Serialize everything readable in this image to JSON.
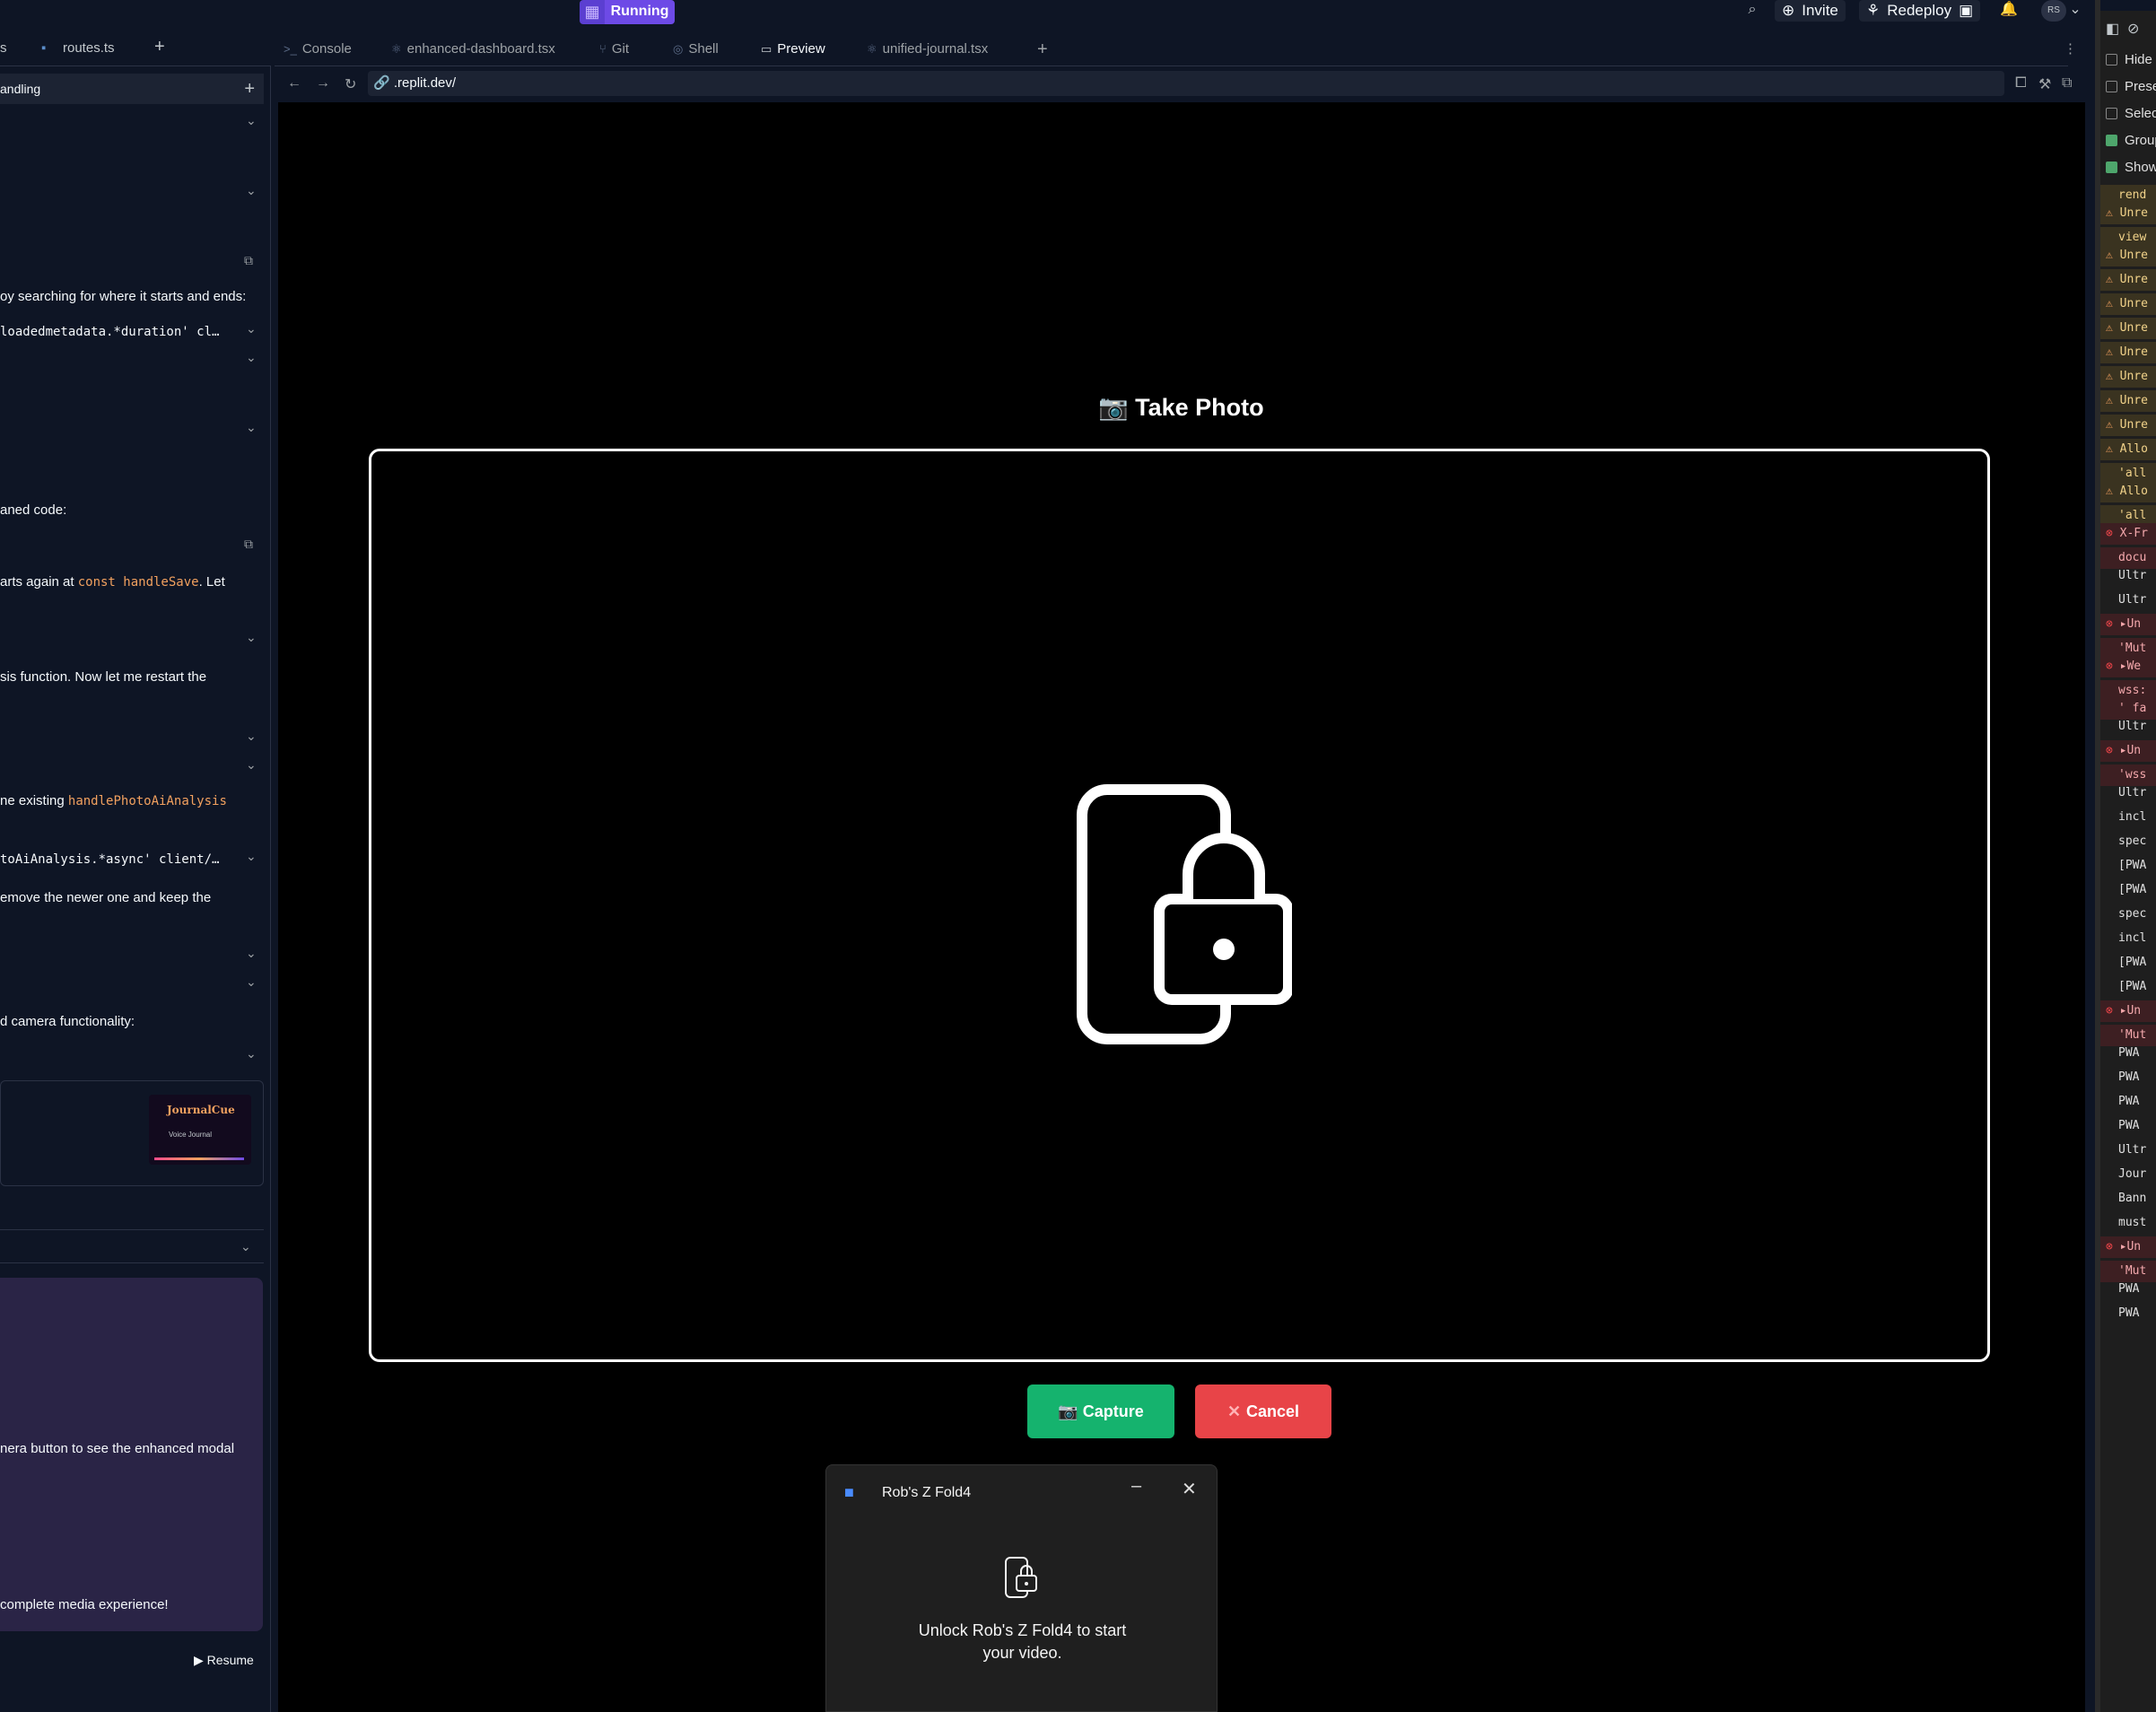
{
  "topbar": {
    "run_status": "Running",
    "invite_label": "Invite",
    "redeploy_label": "Redeploy",
    "avatar_initials": "RS"
  },
  "left": {
    "tab_routes": "routes.ts",
    "tab_frag": "s",
    "header_title": "andling",
    "lines": [
      "oy searching for where it starts and ends:",
      "loadedmetadata.*duration' cl…",
      "aned code:",
      "arts again at ",
      ". Let",
      "sis function. Now let me restart the",
      "ne existing ",
      "toAiAnalysis.*async' client/…",
      "emove the newer one and keep the",
      "d camera functionality:",
      "nera button to see the enhanced modal",
      " complete media experience!"
    ],
    "code_handle_save": "const handleSave",
    "code_photo_ai": "handlePhotoAiAnalysis",
    "thumb_title": "JournalCue",
    "thumb_subtitle": "Voice Journal",
    "resume_label": "Resume"
  },
  "tabs": [
    {
      "label": "Console",
      "icon": ">_"
    },
    {
      "label": "enhanced-dashboard.tsx",
      "icon": "⚛"
    },
    {
      "label": "Git",
      "icon": "⑂"
    },
    {
      "label": "Shell",
      "icon": "◎"
    },
    {
      "label": "Preview",
      "icon": "▭"
    },
    {
      "label": "unified-journal.tsx",
      "icon": "⚛"
    }
  ],
  "url": ".replit.dev/",
  "modal": {
    "title": "📷 Take Photo",
    "capture_label": "📷 Capture",
    "cancel_label": "Cancel"
  },
  "device_popup": {
    "title": "Rob's Z Fold4",
    "message": "Unlock Rob's Z Fold4 to start your video."
  },
  "devtools": {
    "checkboxes": [
      {
        "label": "Hide",
        "checked": false
      },
      {
        "label": "Prese",
        "checked": false
      },
      {
        "label": "Selec",
        "checked": false
      },
      {
        "label": "Group",
        "checked": true
      },
      {
        "label": "Show",
        "checked": true
      }
    ],
    "rows": [
      {
        "text": "rend",
        "kind": "warn-cont"
      },
      {
        "text": "Unre",
        "kind": "warn"
      },
      {
        "text": "view",
        "kind": "warn-cont"
      },
      {
        "text": "Unre",
        "kind": "warn"
      },
      {
        "text": "Unre",
        "kind": "warn"
      },
      {
        "text": "Unre",
        "kind": "warn"
      },
      {
        "text": "Unre",
        "kind": "warn"
      },
      {
        "text": "Unre",
        "kind": "warn"
      },
      {
        "text": "Unre",
        "kind": "warn"
      },
      {
        "text": "Unre",
        "kind": "warn"
      },
      {
        "text": "Unre",
        "kind": "warn"
      },
      {
        "text": "Allo",
        "kind": "warn"
      },
      {
        "text": "'all",
        "kind": "warn-cont"
      },
      {
        "text": "Allo",
        "kind": "warn"
      },
      {
        "text": "'all",
        "kind": "warn-cont"
      },
      {
        "text": "X-Fr",
        "kind": "err"
      },
      {
        "text": "docu",
        "kind": "err-cont"
      },
      {
        "text": "Ultr",
        "kind": "log"
      },
      {
        "text": "Ultr",
        "kind": "log"
      },
      {
        "text": "▸Un",
        "kind": "err"
      },
      {
        "text": "'Mut",
        "kind": "err-cont"
      },
      {
        "text": "▸We",
        "kind": "err"
      },
      {
        "text": "wss:",
        "kind": "err-cont"
      },
      {
        "text": "' fa",
        "kind": "err-cont"
      },
      {
        "text": "Ultr",
        "kind": "log"
      },
      {
        "text": "▸Un",
        "kind": "err"
      },
      {
        "text": "'wss",
        "kind": "err-cont"
      },
      {
        "text": "Ultr",
        "kind": "log"
      },
      {
        "text": "incl",
        "kind": "log"
      },
      {
        "text": "spec",
        "kind": "log"
      },
      {
        "text": "[PWA",
        "kind": "log"
      },
      {
        "text": "[PWA",
        "kind": "log"
      },
      {
        "text": "spec",
        "kind": "log"
      },
      {
        "text": "incl",
        "kind": "log"
      },
      {
        "text": "[PWA",
        "kind": "log"
      },
      {
        "text": "[PWA",
        "kind": "log"
      },
      {
        "text": "▸Un",
        "kind": "err"
      },
      {
        "text": "'Mut",
        "kind": "err-cont"
      },
      {
        "text": "PWA",
        "kind": "log"
      },
      {
        "text": "PWA",
        "kind": "log"
      },
      {
        "text": "PWA",
        "kind": "log"
      },
      {
        "text": "PWA",
        "kind": "log"
      },
      {
        "text": "Ultr",
        "kind": "log"
      },
      {
        "text": "Jour",
        "kind": "log"
      },
      {
        "text": "Bann",
        "kind": "log"
      },
      {
        "text": "must",
        "kind": "log"
      },
      {
        "text": "▸Un",
        "kind": "err"
      },
      {
        "text": "'Mut",
        "kind": "err-cont"
      },
      {
        "text": "PWA",
        "kind": "log"
      },
      {
        "text": "PWA",
        "kind": "log"
      }
    ]
  }
}
